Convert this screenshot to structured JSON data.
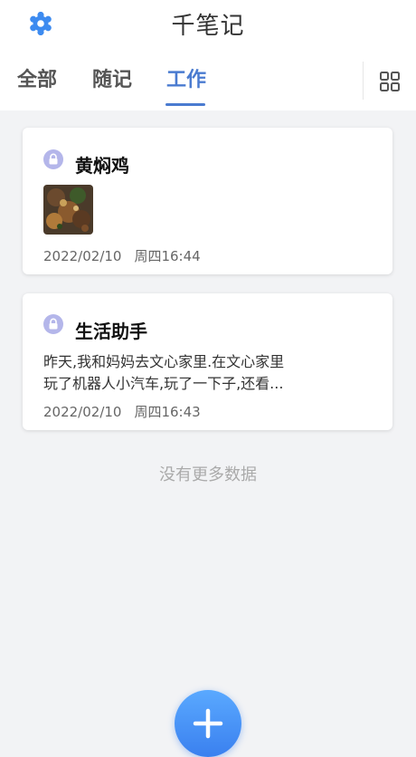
{
  "header": {
    "title": "千笔记",
    "settings_icon": "gear-icon",
    "accent_color": "#4a7bd0"
  },
  "tabs": [
    {
      "label": "全部",
      "active": false
    },
    {
      "label": "随记",
      "active": false
    },
    {
      "label": "工作",
      "active": true
    }
  ],
  "view_toggle_icon": "grid-view-icon",
  "notes": [
    {
      "title": "黄焖鸡",
      "locked": true,
      "has_image": true,
      "date": "2022/02/10",
      "weekday_time": "周四16:44"
    },
    {
      "title": "生活助手",
      "locked": true,
      "preview_line1": "昨天,我和妈妈去文心家里.在文心家里",
      "preview_line2": "玩了机器人小汽车,玩了一下子,还看...",
      "date": "2022/02/10",
      "weekday_time": "周四16:43"
    }
  ],
  "footer_text": "没有更多数据",
  "fab_icon": "plus-icon"
}
